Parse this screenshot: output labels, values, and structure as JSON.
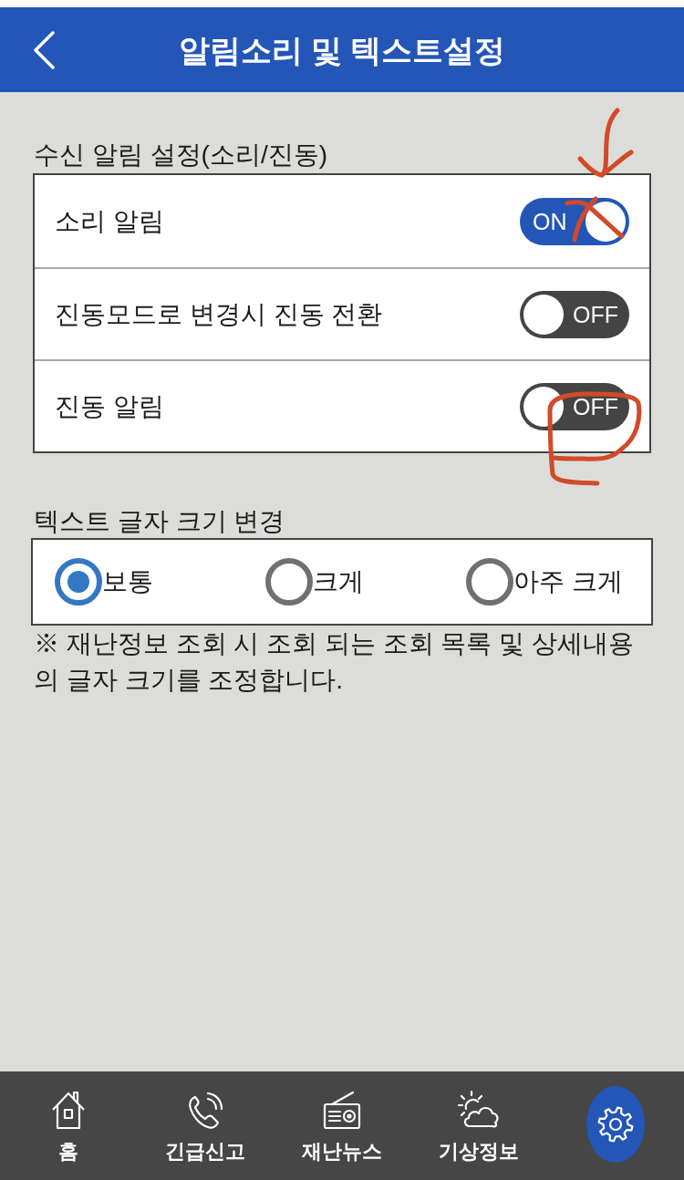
{
  "header": {
    "title": "알림소리 및 텍스트설정"
  },
  "notification_section": {
    "title": "수신 알림 설정(소리/진동)",
    "rows": [
      {
        "label": "소리 알림",
        "on": true,
        "switch_text": "ON",
        "annotations": [
          {
            "kind": "arrow"
          },
          {
            "kind": "cross"
          }
        ]
      },
      {
        "label": "진동모드로 변경시 진동 전환",
        "on": false,
        "switch_text": "OFF"
      },
      {
        "label": "진동 알림",
        "on": false,
        "switch_text": "OFF",
        "annotations": [
          {
            "kind": "loop"
          }
        ]
      }
    ]
  },
  "text_size_section": {
    "title": "텍스트 글자 크기 변경",
    "options": [
      {
        "label": "보통",
        "selected": true
      },
      {
        "label": "크게",
        "selected": false
      },
      {
        "label": "아주 크게",
        "selected": false
      }
    ],
    "note": "※ 재난정보 조회 시 조회 되는 조회 목록 및 상세내용의 글자 크기를 조정합니다."
  },
  "bottom_nav": {
    "items": [
      {
        "kind": "home",
        "label": "홈",
        "selected": false
      },
      {
        "kind": "phone",
        "label": "긴급신고",
        "selected": false
      },
      {
        "kind": "radio",
        "label": "재난뉴스",
        "selected": false
      },
      {
        "kind": "weather",
        "label": "기상정보",
        "selected": false
      },
      {
        "kind": "settings",
        "selected": true
      }
    ]
  }
}
